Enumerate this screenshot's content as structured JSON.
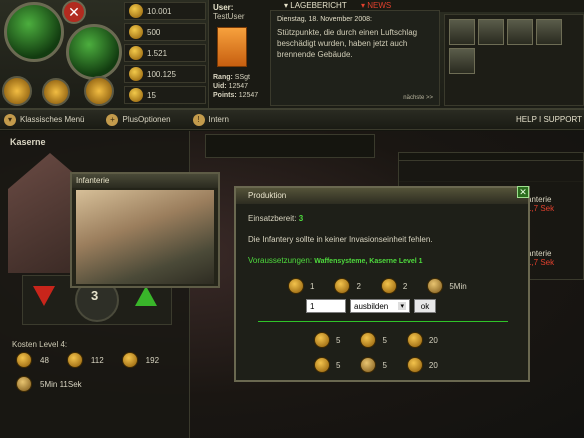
{
  "resources": [
    {
      "name": "coins-icon",
      "value": "10.001"
    },
    {
      "name": "oil-icon",
      "value": "500"
    },
    {
      "name": "fuel-icon",
      "value": "1.521"
    },
    {
      "name": "ammo-icon",
      "value": "100.125"
    },
    {
      "name": "tools-icon",
      "value": "15"
    }
  ],
  "user": {
    "label": "User:",
    "name": "TestUser",
    "rank_label": "Rang:",
    "rank": "SSgt",
    "uid_label": "Uid:",
    "uid": "12547",
    "points_label": "Points:",
    "points": "12547"
  },
  "tabs": {
    "lagebericht": "LAGEBERICHT",
    "news": "NEWS"
  },
  "news": {
    "date": "Dienstag, 18. November 2008:",
    "text": "Stützpunkte, die durch einen Luftschlag beschädigt wurden, haben jetzt auch brennende Gebäude.",
    "more": "nächste >>"
  },
  "menu": {
    "classic": "Klassisches Menü",
    "plus": "PlusOptionen",
    "intern": "Intern",
    "help": "HELP",
    "support": "SUPPORT",
    "separator": "I"
  },
  "kaserne": {
    "title": "Kaserne",
    "level_cost_label": "Kosten Level 4:",
    "costs": [
      "48",
      "112",
      "192"
    ],
    "time": "5Min 11Sek",
    "queue_count": "3"
  },
  "infantry_window": {
    "title": "Infanterie"
  },
  "production": {
    "title": "Produktion",
    "ready_label": "Einsatzbereit:",
    "ready_value": "3",
    "description": "Die Infantery sollte in keiner Invasionseinheit fehlen.",
    "prereq_label": "Voraussetzungen:",
    "prereq_value": "Waffensysteme, Kaserne Level 1",
    "costs": [
      {
        "icon": "coin-icon",
        "value": "1"
      },
      {
        "icon": "oil-icon",
        "value": "2"
      },
      {
        "icon": "fuel-icon",
        "value": "2"
      },
      {
        "icon": "clock-icon",
        "value": "5Min"
      }
    ],
    "quantity": "1",
    "action_selected": "ausbilden",
    "ok_label": "ok",
    "stats_row1": [
      {
        "icon": "soldier-icon",
        "value": "5"
      },
      {
        "icon": "plane-icon",
        "value": "5"
      },
      {
        "icon": "shield-icon",
        "value": "20"
      }
    ],
    "stats_row2": [
      {
        "icon": "crate-icon",
        "value": "5"
      },
      {
        "icon": "hourglass-icon",
        "value": "5"
      },
      {
        "icon": "fuel-can-icon",
        "value": "20"
      }
    ]
  },
  "right_panel": {
    "label1": "anterie",
    "value1": "1,7 Sek",
    "label2": "anterie",
    "value2": "1,7 Sek"
  },
  "colors": {
    "accent_green": "#4eda3d",
    "red_text": "#e0402d",
    "chevron_orange": "#f29a3a"
  }
}
